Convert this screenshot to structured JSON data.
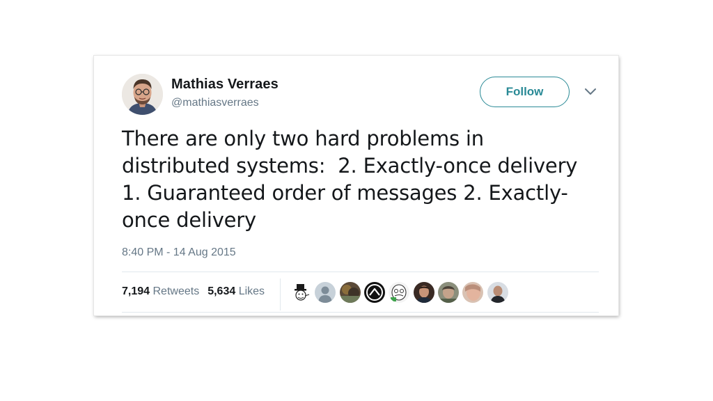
{
  "tweet": {
    "author_name": "Mathias Verraes",
    "author_handle": "@mathiasverraes",
    "follow_label": "Follow",
    "text": "There are only two hard problems in\ndistributed systems:  2. Exactly-once delivery\n1. Guaranteed order of messages 2. Exactly-\nonce delivery",
    "timestamp": "8:40 PM - 14 Aug 2015",
    "retweets_count": "7,194",
    "retweets_label": "Retweets",
    "likes_count": "5,634",
    "likes_label": "Likes"
  },
  "liker_avatars": [
    {
      "icon": "top-hat-meme-avatar"
    },
    {
      "icon": "default-user-avatar"
    },
    {
      "icon": "photo-avatar"
    },
    {
      "icon": "mountain-logo-avatar"
    },
    {
      "icon": "cartoon-face-avatar"
    },
    {
      "icon": "photo-avatar"
    },
    {
      "icon": "photo-avatar"
    },
    {
      "icon": "photo-avatar"
    },
    {
      "icon": "photo-avatar"
    }
  ],
  "colors": {
    "accent": "#2a8a96",
    "text_primary": "#14171a",
    "text_secondary": "#657786",
    "divider": "#e1e8ed"
  }
}
